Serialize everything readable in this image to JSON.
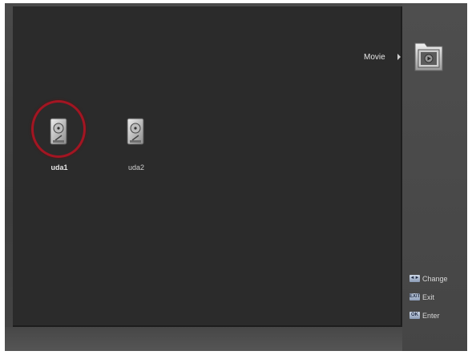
{
  "header": {
    "category_label": "Movie",
    "category_icon": "movie-folder-icon"
  },
  "drives": [
    {
      "label": "uda1",
      "icon": "hard-disk-icon",
      "selected": true
    },
    {
      "label": "uda2",
      "icon": "hard-disk-icon",
      "selected": false
    }
  ],
  "legend": {
    "change": {
      "key": "◄►",
      "label": "Change"
    },
    "exit": {
      "key": "EXIT",
      "label": "Exit"
    },
    "enter": {
      "key": "OK",
      "label": "Enter"
    }
  },
  "colors": {
    "selection_ring": "#a31522",
    "panel_background": "#2b2b2b",
    "frame_background": "#454545",
    "key_badge": "#8a9ab5"
  }
}
